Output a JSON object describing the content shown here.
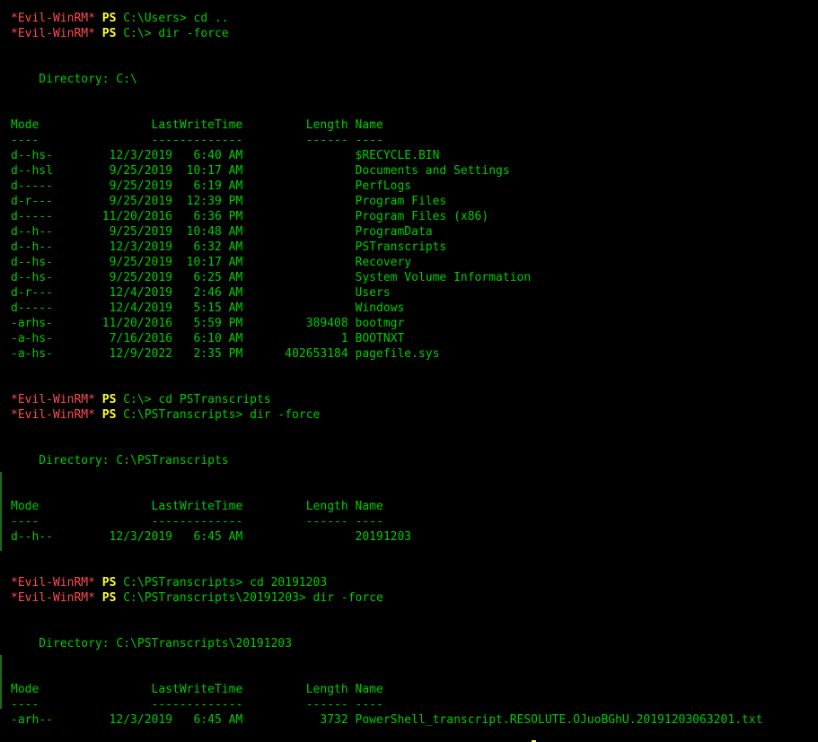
{
  "prompt": {
    "tag": "*Evil-WinRM*",
    "ps": "PS"
  },
  "lines": {
    "l0": "C:\\Users> cd ..",
    "l1": "C:\\> dir -force",
    "l2": "    Directory: C:\\",
    "l3": "Mode                LastWriteTime         Length Name",
    "l4": "----                -------------         ------ ----",
    "l5": "d--hs-        12/3/2019   6:40 AM                $RECYCLE.BIN",
    "l6": "d--hsl        9/25/2019  10:17 AM                Documents and Settings",
    "l7": "d-----        9/25/2019   6:19 AM                PerfLogs",
    "l8": "d-r---        9/25/2019  12:39 PM                Program Files",
    "l9": "d-----       11/20/2016   6:36 PM                Program Files (x86)",
    "l10": "d--h--        9/25/2019  10:48 AM                ProgramData",
    "l11": "d--h--        12/3/2019   6:32 AM                PSTranscripts",
    "l12": "d--hs-        9/25/2019  10:17 AM                Recovery",
    "l13": "d--hs-        9/25/2019   6:25 AM                System Volume Information",
    "l14": "d-r---        12/4/2019   2:46 AM                Users",
    "l15": "d-----        12/4/2019   5:15 AM                Windows",
    "l16": "-arhs-       11/20/2016   5:59 PM         389408 bootmgr",
    "l17": "-a-hs-        7/16/2016   6:10 AM              1 BOOTNXT",
    "l18": "-a-hs-        12/9/2022   2:35 PM      402653184 pagefile.sys",
    "l19": "C:\\> cd PSTranscripts",
    "l20": "C:\\PSTranscripts> dir -force",
    "l21": "    Directory: C:\\PSTranscripts",
    "l22": "Mode                LastWriteTime         Length Name",
    "l23": "----                -------------         ------ ----",
    "l24": "d--h--        12/3/2019   6:45 AM                20191203",
    "l25": "C:\\PSTranscripts> cd 20191203",
    "l26": "C:\\PSTranscripts\\20191203> dir -force",
    "l27": "    Directory: C:\\PSTranscripts\\20191203",
    "l28": "Mode                LastWriteTime         Length Name",
    "l29": "----                -------------         ------ ----",
    "l30": "-arh--        12/3/2019   6:45 AM           3732 PowerShell_transcript.RESOLUTE.OJuoBGhU.20191203063201.txt"
  },
  "colors": {
    "background": "#000000",
    "text": "#00cc00",
    "prompt_tag": "#ff4d4d",
    "ps_tag": "#ffff33"
  }
}
